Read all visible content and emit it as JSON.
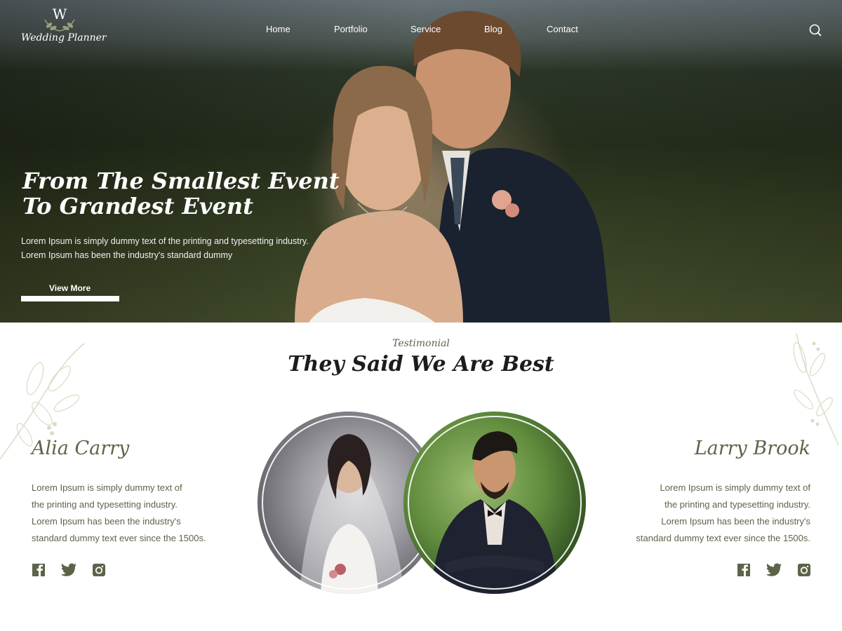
{
  "brand": {
    "monogram": "W",
    "name": "Wedding Planner"
  },
  "nav": {
    "items": [
      "Home",
      "Portfolio",
      "Service",
      "Blog",
      "Contact"
    ]
  },
  "hero": {
    "title_line1": "From The Smallest Event",
    "title_line2": "To Grandest Event",
    "text_line1": "Lorem Ipsum is simply dummy text of the printing and typesetting industry.",
    "text_line2": "Lorem Ipsum has been the industry's standard dummy",
    "cta_label": "View More"
  },
  "testimonial": {
    "kicker": "Testimonial",
    "title": "They Said We Are Best",
    "people": [
      {
        "name": "Alia Carry",
        "lines": [
          "Lorem Ipsum is simply dummy text of",
          "the printing and typesetting industry.",
          "Lorem Ipsum has been the industry's",
          "standard dummy text ever since the 1500s."
        ]
      },
      {
        "name": "Larry Brook",
        "lines": [
          "Lorem Ipsum is simply dummy text of",
          "the printing and typesetting industry.",
          "Lorem Ipsum has been the industry's",
          "standard dummy text ever since the 1500s."
        ]
      }
    ]
  },
  "icons": {
    "search": "search-icon",
    "social": [
      "facebook-icon",
      "twitter-icon",
      "instagram-icon"
    ]
  },
  "colors": {
    "accent": "#5c6448",
    "hero_text": "#ffffff",
    "heading": "#1c1c1c"
  }
}
